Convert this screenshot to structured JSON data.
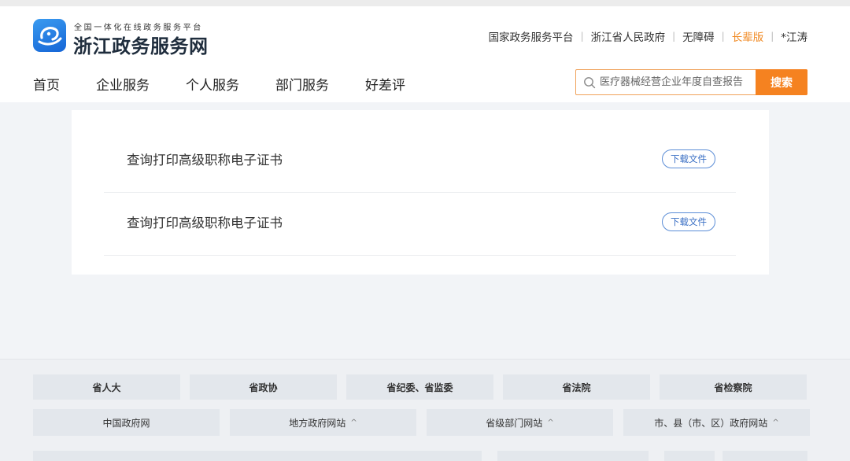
{
  "header": {
    "brand_subtitle": "全国一体化在线政务服务平台",
    "brand_title": "浙江政务服务网",
    "top_links": [
      "国家政务服务平台",
      "浙江省人民政府",
      "无障碍",
      "长辈版",
      "*江涛"
    ],
    "nav": [
      "首页",
      "企业服务",
      "个人服务",
      "部门服务",
      "好差评"
    ],
    "search": {
      "placeholder": "医疗器械经营企业年度自查报告",
      "button": "搜索"
    }
  },
  "list": {
    "items": [
      {
        "title": "查询打印高级职称电子证书",
        "action": "下载文件"
      },
      {
        "title": "查询打印高级职称电子证书",
        "action": "下载文件"
      }
    ]
  },
  "footer": {
    "row1": [
      "省人大",
      "省政协",
      "省纪委、省监委",
      "省法院",
      "省检察院"
    ],
    "row2": [
      {
        "label": "中国政府网",
        "chevron": false
      },
      {
        "label": "地方政府网站",
        "chevron": true
      },
      {
        "label": "省级部门网站",
        "chevron": true
      },
      {
        "label": "市、县（市、区）政府网站",
        "chevron": true
      }
    ],
    "chevron": "^"
  },
  "colors": {
    "accent": "#f58220",
    "link_blue": "#3a6fc4",
    "orange_link": "#f08a24"
  }
}
